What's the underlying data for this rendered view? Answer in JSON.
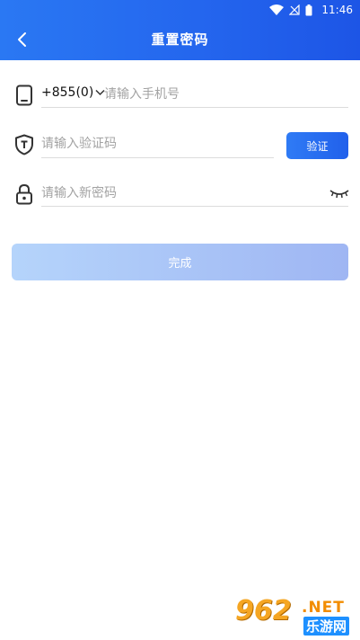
{
  "status_bar": {
    "time": "11:46"
  },
  "header": {
    "title": "重置密码",
    "back_icon": "chevron-left-icon"
  },
  "phone_row": {
    "icon": "phone-icon",
    "country_code": "+855(0)",
    "dropdown_icon": "chevron-down-icon",
    "placeholder": "请输入手机号",
    "value": ""
  },
  "code_row": {
    "icon": "shield-icon",
    "placeholder": "请输入验证码",
    "value": "",
    "verify_label": "验证"
  },
  "password_row": {
    "icon": "lock-icon",
    "placeholder": "请输入新密码",
    "value": "",
    "toggle_icon": "eye-closed-icon"
  },
  "submit": {
    "label": "完成"
  },
  "watermark": {
    "main": "962",
    "net": ".NET",
    "sub": "乐游网"
  },
  "colors": {
    "header_start": "#2a78f3",
    "header_end": "#1d55e6",
    "accent": "#2160eb",
    "submit_disabled_start": "#b5d4fb",
    "submit_disabled_end": "#9fb6f3"
  }
}
